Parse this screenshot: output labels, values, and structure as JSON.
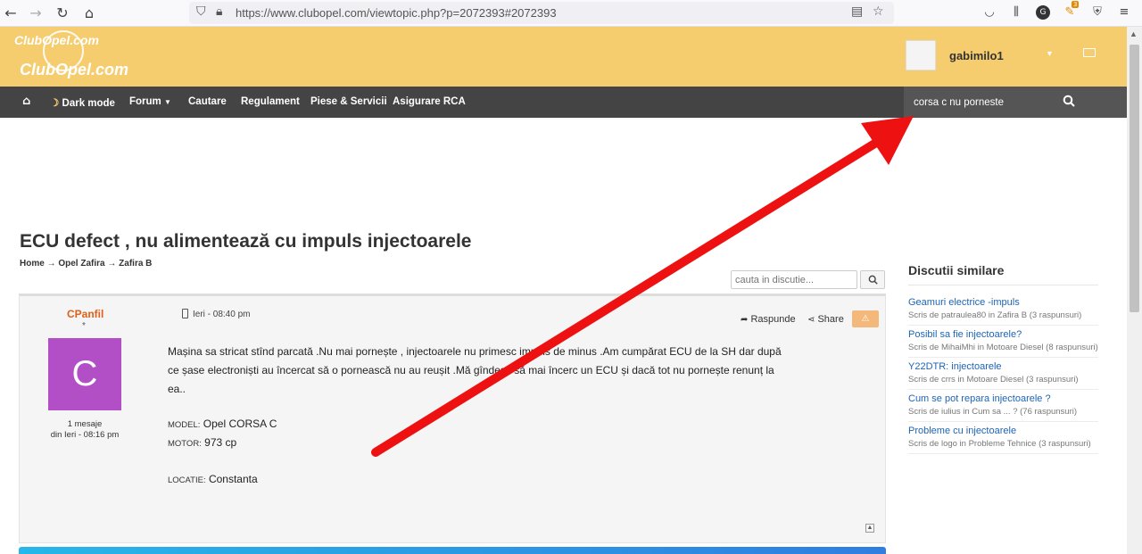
{
  "browser": {
    "url": "https://www.clubopel.com/viewtopic.php?p=2072393#2072393",
    "nav_icons": [
      "back-icon",
      "forward-icon",
      "reload-icon",
      "home-icon"
    ],
    "toolbar_icons": [
      "pocket-icon",
      "library-icon",
      "account-icon",
      "extension-icon",
      "shield-icon",
      "menu-icon"
    ],
    "extension_badge": "3"
  },
  "site": {
    "logo_small": "ClubOpel.com",
    "logo_big": "ClubOpel.com",
    "username": "gabimilo1"
  },
  "nav": {
    "dark_mode": "Dark mode",
    "forum": "Forum",
    "search": "Cautare",
    "rules": "Regulament",
    "parts": "Piese & Servicii",
    "insurance": "Asigurare RCA",
    "search_value": "corsa c nu porneste"
  },
  "topic": {
    "title": "ECU defect , nu alimentează cu impuls injectoarele",
    "breadcrumb": [
      "Home",
      "Opel Zafira",
      "Zafira B"
    ],
    "search_placeholder": "cauta in discutie..."
  },
  "post": {
    "author": "CPanfil",
    "rank": "*",
    "avatar_letter": "C",
    "messages": "1 mesaje",
    "since": "din Ieri - 08:16 pm",
    "time": "Ieri - 08:40 pm",
    "reply": "Raspunde",
    "share": "Share",
    "body": "Mașina sa stricat stînd parcată .Nu mai pornește , injectoarele nu primesc impuls de minus .Am cumpărat ECU de la SH dar după ce șase electroniști au încercat să o pornească nu au reușit .Mă gîndesc să mai încerc un ECU și dacă tot nu pornește renunț la ea..",
    "model_label": "MODEL:",
    "model_value": "Opel CORSA C",
    "motor_label": "MOTOR:",
    "motor_value": "973 cp",
    "location_label": "LOCATIE:",
    "location_value": "Constanta"
  },
  "sidebar": {
    "title": "Discutii similare",
    "items": [
      {
        "title": "Geamuri electrice -impuls",
        "meta": "Scris de patraulea80 in Zafira B (3 raspunsuri)"
      },
      {
        "title": "Posibil sa fie injectoarele?",
        "meta": "Scris de MihaiMhi in Motoare Diesel (8 raspunsuri)"
      },
      {
        "title": "Y22DTR: injectoarele",
        "meta": "Scris de crrs in Motoare Diesel (3 raspunsuri)"
      },
      {
        "title": "Cum se pot repara injectoarele ?",
        "meta": "Scris de iulius in Cum sa ... ? (76 raspunsuri)"
      },
      {
        "title": "Probleme cu injectoarele",
        "meta": "Scris de logo in Probleme Tehnice (3 raspunsuri)"
      }
    ]
  },
  "colors": {
    "header": "#f5cc6e",
    "nav": "#444444",
    "author": "#e0601b",
    "link": "#1e64b4",
    "avatar": "#b24fc7",
    "annotation": "#ee1111"
  }
}
